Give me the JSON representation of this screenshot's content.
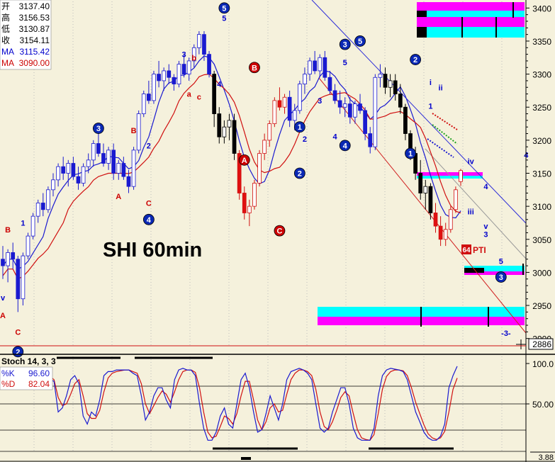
{
  "chart_data": {
    "type": "candlestick",
    "title": "SHI 60min",
    "timeframe": "60min",
    "price_axis": {
      "ticks": [
        2900,
        2950,
        3000,
        3050,
        3100,
        3150,
        3200,
        3250,
        3300,
        3350,
        3400
      ],
      "tick_labels": [
        "2900",
        "2950",
        "3000",
        "3050",
        "3100",
        "3150",
        "3200",
        "3250",
        "3300",
        "3350",
        "3400"
      ],
      "ylim": [
        2890,
        3410
      ],
      "current_marker": "2886"
    },
    "info_box": [
      {
        "label": "开",
        "value": "3137.40",
        "color": "#000000"
      },
      {
        "label": "高",
        "value": "3156.53",
        "color": "#000000"
      },
      {
        "label": "低",
        "value": "3130.87",
        "color": "#000000"
      },
      {
        "label": "收",
        "value": "3154.11",
        "color": "#000000"
      },
      {
        "label": "MA",
        "value": "3115.42",
        "color": "#0000cc"
      },
      {
        "label": "MA",
        "value": "3090.00",
        "color": "#cc0000"
      }
    ],
    "ohlc": [
      [
        3020,
        3040,
        2990,
        3010
      ],
      [
        3010,
        3035,
        2985,
        3030
      ],
      [
        3030,
        3045,
        3005,
        3020
      ],
      [
        3020,
        3025,
        2940,
        2960
      ],
      [
        2960,
        3030,
        2950,
        3025
      ],
      [
        3025,
        3060,
        3020,
        3055
      ],
      [
        3055,
        3090,
        3050,
        3085
      ],
      [
        3085,
        3110,
        3075,
        3105
      ],
      [
        3105,
        3120,
        3085,
        3095
      ],
      [
        3095,
        3130,
        3090,
        3125
      ],
      [
        3125,
        3150,
        3115,
        3140
      ],
      [
        3140,
        3165,
        3130,
        3160
      ],
      [
        3160,
        3175,
        3140,
        3150
      ],
      [
        3150,
        3170,
        3130,
        3165
      ],
      [
        3165,
        3175,
        3140,
        3145
      ],
      [
        3145,
        3160,
        3125,
        3135
      ],
      [
        3135,
        3165,
        3130,
        3160
      ],
      [
        3160,
        3180,
        3150,
        3170
      ],
      [
        3170,
        3200,
        3160,
        3195
      ],
      [
        3195,
        3215,
        3175,
        3180
      ],
      [
        3180,
        3195,
        3160,
        3165
      ],
      [
        3165,
        3190,
        3155,
        3185
      ],
      [
        3185,
        3195,
        3140,
        3150
      ],
      [
        3150,
        3170,
        3140,
        3165
      ],
      [
        3165,
        3175,
        3140,
        3145
      ],
      [
        3145,
        3155,
        3120,
        3130
      ],
      [
        3130,
        3190,
        3125,
        3185
      ],
      [
        3185,
        3245,
        3180,
        3240
      ],
      [
        3240,
        3275,
        3235,
        3270
      ],
      [
        3270,
        3290,
        3255,
        3260
      ],
      [
        3260,
        3305,
        3255,
        3300
      ],
      [
        3300,
        3320,
        3280,
        3290
      ],
      [
        3290,
        3310,
        3275,
        3305
      ],
      [
        3305,
        3315,
        3285,
        3295
      ],
      [
        3295,
        3300,
        3275,
        3285
      ],
      [
        3285,
        3320,
        3280,
        3315
      ],
      [
        3315,
        3330,
        3295,
        3300
      ],
      [
        3300,
        3325,
        3290,
        3320
      ],
      [
        3320,
        3345,
        3310,
        3340
      ],
      [
        3340,
        3365,
        3330,
        3360
      ],
      [
        3360,
        3365,
        3320,
        3330
      ],
      [
        3330,
        3335,
        3295,
        3300
      ],
      [
        3300,
        3305,
        3220,
        3240
      ],
      [
        3240,
        3250,
        3195,
        3205
      ],
      [
        3205,
        3230,
        3195,
        3220
      ],
      [
        3220,
        3240,
        3200,
        3230
      ],
      [
        3230,
        3240,
        3170,
        3180
      ],
      [
        3180,
        3185,
        3110,
        3120
      ],
      [
        3120,
        3130,
        3080,
        3090
      ],
      [
        3090,
        3110,
        3070,
        3100
      ],
      [
        3100,
        3140,
        3095,
        3135
      ],
      [
        3135,
        3185,
        3130,
        3180
      ],
      [
        3180,
        3210,
        3170,
        3200
      ],
      [
        3200,
        3230,
        3190,
        3225
      ],
      [
        3225,
        3265,
        3220,
        3260
      ],
      [
        3260,
        3280,
        3245,
        3250
      ],
      [
        3250,
        3270,
        3240,
        3265
      ],
      [
        3265,
        3275,
        3220,
        3230
      ],
      [
        3230,
        3255,
        3215,
        3245
      ],
      [
        3245,
        3290,
        3240,
        3285
      ],
      [
        3285,
        3310,
        3270,
        3300
      ],
      [
        3300,
        3325,
        3290,
        3320
      ],
      [
        3320,
        3335,
        3300,
        3305
      ],
      [
        3305,
        3330,
        3295,
        3325
      ],
      [
        3325,
        3335,
        3290,
        3295
      ],
      [
        3295,
        3305,
        3270,
        3275
      ],
      [
        3275,
        3285,
        3255,
        3260
      ],
      [
        3260,
        3275,
        3240,
        3250
      ],
      [
        3250,
        3265,
        3235,
        3255
      ],
      [
        3255,
        3265,
        3225,
        3235
      ],
      [
        3235,
        3260,
        3225,
        3255
      ],
      [
        3255,
        3270,
        3240,
        3245
      ],
      [
        3245,
        3250,
        3200,
        3210
      ],
      [
        3210,
        3220,
        3180,
        3190
      ],
      [
        3190,
        3300,
        3185,
        3295
      ],
      [
        3295,
        3315,
        3280,
        3300
      ],
      [
        3300,
        3310,
        3270,
        3280
      ],
      [
        3280,
        3300,
        3265,
        3290
      ],
      [
        3290,
        3300,
        3260,
        3270
      ],
      [
        3270,
        3285,
        3240,
        3250
      ],
      [
        3250,
        3255,
        3200,
        3210
      ],
      [
        3210,
        3215,
        3170,
        3180
      ],
      [
        3180,
        3190,
        3140,
        3150
      ],
      [
        3150,
        3170,
        3110,
        3120
      ],
      [
        3120,
        3140,
        3095,
        3130
      ],
      [
        3130,
        3135,
        3080,
        3090
      ],
      [
        3090,
        3105,
        3060,
        3070
      ],
      [
        3070,
        3085,
        3040,
        3050
      ],
      [
        3050,
        3075,
        3040,
        3065
      ],
      [
        3065,
        3100,
        3060,
        3095
      ],
      [
        3095,
        3130,
        3090,
        3125
      ],
      [
        3137.4,
        3156.53,
        3130.87,
        3154.11
      ]
    ],
    "wave_labels": [
      {
        "text": "A",
        "i": 0,
        "price": 2935,
        "style": "plain",
        "color": "#cc0000"
      },
      {
        "text": "v",
        "i": 0,
        "price": 2962,
        "style": "plain",
        "color": "#0000cc"
      },
      {
        "text": "B",
        "i": 1,
        "price": 3065,
        "style": "plain",
        "color": "#cc0000"
      },
      {
        "text": "C",
        "i": 3,
        "price": 2910,
        "style": "plain",
        "color": "#cc0000"
      },
      {
        "text": "2",
        "i": 3,
        "price": 2880,
        "style": "circle",
        "color": "#0a28b4"
      },
      {
        "text": "1",
        "i": 4,
        "price": 3075,
        "style": "plain",
        "color": "#0000cc"
      },
      {
        "text": "3",
        "i": 19,
        "price": 3218,
        "style": "circle",
        "color": "#0a28b4"
      },
      {
        "text": "A",
        "i": 23,
        "price": 3115,
        "style": "plain",
        "color": "#cc0000"
      },
      {
        "text": "B",
        "i": 26,
        "price": 3215,
        "style": "plain",
        "color": "#cc0000"
      },
      {
        "text": "2",
        "i": 29,
        "price": 3192,
        "style": "plain",
        "color": "#0000cc"
      },
      {
        "text": "C",
        "i": 29,
        "price": 3105,
        "style": "plain",
        "color": "#cc0000"
      },
      {
        "text": "4",
        "i": 29,
        "price": 3080,
        "style": "circle",
        "color": "#0a28b4"
      },
      {
        "text": "3",
        "i": 36,
        "price": 3330,
        "style": "plain",
        "color": "#0000cc"
      },
      {
        "text": "b",
        "i": 38,
        "price": 3325,
        "style": "plain",
        "color": "#cc0000"
      },
      {
        "text": "a",
        "i": 37,
        "price": 3270,
        "style": "plain",
        "color": "#cc0000"
      },
      {
        "text": "c",
        "i": 39,
        "price": 3266,
        "style": "plain",
        "color": "#cc0000"
      },
      {
        "text": "4",
        "i": 43,
        "price": 3285,
        "style": "plain",
        "color": "#0000cc"
      },
      {
        "text": "5",
        "i": 44,
        "price": 3385,
        "style": "plain",
        "color": "#0000cc"
      },
      {
        "text": "5",
        "i": 44,
        "price": 3400,
        "style": "circle",
        "color": "#0a28b4"
      },
      {
        "text": "B",
        "i": 50,
        "price": 3310,
        "style": "circle",
        "color": "#cc0000"
      },
      {
        "text": "A",
        "i": 48,
        "price": 3170,
        "style": "circle",
        "color": "#cc0000"
      },
      {
        "text": "C",
        "i": 55,
        "price": 3063,
        "style": "circle",
        "color": "#cc0000"
      },
      {
        "text": "1",
        "i": 59,
        "price": 3220,
        "style": "circle",
        "color": "#0a28b4"
      },
      {
        "text": "2",
        "i": 60,
        "price": 3202,
        "style": "plain",
        "color": "#0000cc"
      },
      {
        "text": "2",
        "i": 59,
        "price": 3150,
        "style": "circle",
        "color": "#0a28b4"
      },
      {
        "text": "3",
        "i": 63,
        "price": 3260,
        "style": "plain",
        "color": "#0000cc"
      },
      {
        "text": "4",
        "i": 66,
        "price": 3206,
        "style": "plain",
        "color": "#0000cc"
      },
      {
        "text": "4",
        "i": 68,
        "price": 3192,
        "style": "circle",
        "color": "#0a28b4"
      },
      {
        "text": "3",
        "i": 68,
        "price": 3345,
        "style": "circle",
        "color": "#0a28b4"
      },
      {
        "text": "5",
        "i": 68,
        "price": 3318,
        "style": "plain",
        "color": "#0000cc"
      },
      {
        "text": "5",
        "i": 71,
        "price": 3350,
        "style": "circle",
        "color": "#0a28b4"
      },
      {
        "text": "1",
        "i": 81,
        "price": 3180,
        "style": "circle",
        "color": "#0a28b4"
      },
      {
        "text": "2",
        "i": 82,
        "price": 3322,
        "style": "circle",
        "color": "#0a28b4"
      },
      {
        "text": "i",
        "i": 85,
        "price": 3288,
        "style": "plain",
        "color": "#0000cc"
      },
      {
        "text": "ii",
        "i": 87,
        "price": 3280,
        "style": "plain",
        "color": "#0000cc"
      },
      {
        "text": "1",
        "i": 85,
        "price": 3252,
        "style": "plain",
        "color": "#0000cc"
      },
      {
        "text": "iv",
        "i": 93,
        "price": 3168,
        "style": "plain",
        "color": "#0000cc"
      },
      {
        "text": "4",
        "i": 96,
        "price": 3130,
        "style": "plain",
        "color": "#0000cc"
      },
      {
        "text": "iii",
        "i": 93,
        "price": 3092,
        "style": "plain",
        "color": "#0000cc"
      },
      {
        "text": "v",
        "i": 96,
        "price": 3070,
        "style": "plain",
        "color": "#0000cc"
      },
      {
        "text": "3",
        "i": 96,
        "price": 3058,
        "style": "plain",
        "color": "#0000cc"
      },
      {
        "text": "5",
        "i": 99,
        "price": 3017,
        "style": "plain",
        "color": "#0000cc"
      },
      {
        "text": "3",
        "i": 99,
        "price": 2993,
        "style": "circle",
        "color": "#0a28b4"
      },
      {
        "text": "4",
        "i": 104,
        "price": 3178,
        "style": "plain",
        "color": "#0000cc"
      },
      {
        "text": "-3-",
        "i": 100,
        "price": 2908,
        "style": "plain",
        "color": "#0000cc"
      }
    ],
    "pti": {
      "value": "64",
      "label": "PTI"
    },
    "chart_title": "SHI 60min",
    "oscillator": {
      "name": "Stoch 14, 3, 3",
      "k_label": "%K",
      "k_value": "96.60",
      "d_label": "%D",
      "d_value": "82.04",
      "ticks": [
        "100.0",
        "50.00"
      ],
      "bottom_label": "3.88",
      "k": [
        85,
        88,
        90,
        92,
        92,
        93,
        88,
        75,
        70,
        88,
        90,
        85,
        80,
        78,
        40,
        45,
        60,
        80,
        85,
        75,
        35,
        25,
        40,
        35,
        55,
        85,
        90,
        90,
        92,
        92,
        92,
        92,
        88,
        85,
        60,
        30,
        40,
        60,
        70,
        70,
        55,
        45,
        80,
        92,
        94,
        92,
        92,
        85,
        50,
        20,
        5,
        5,
        15,
        35,
        45,
        25,
        20,
        50,
        80,
        88,
        70,
        40,
        15,
        18,
        38,
        60,
        45,
        30,
        50,
        80,
        90,
        92,
        94,
        92,
        88,
        80,
        50,
        20,
        15,
        20,
        40,
        55,
        70,
        70,
        50,
        20,
        8,
        5,
        5,
        5,
        20,
        60,
        85,
        92,
        94,
        93,
        92,
        90,
        80,
        60,
        40,
        28,
        15,
        8,
        5,
        5,
        10,
        25,
        70,
        85,
        96.6
      ],
      "d": [
        80,
        85,
        88,
        90,
        91,
        92,
        90,
        82,
        76,
        80,
        86,
        87,
        84,
        80,
        58,
        48,
        50,
        62,
        75,
        80,
        60,
        38,
        32,
        32,
        42,
        65,
        82,
        88,
        90,
        91,
        92,
        92,
        90,
        88,
        75,
        50,
        38,
        48,
        58,
        66,
        62,
        52,
        65,
        80,
        90,
        92,
        92,
        89,
        70,
        40,
        15,
        8,
        10,
        22,
        35,
        32,
        25,
        38,
        60,
        78,
        78,
        55,
        30,
        18,
        28,
        45,
        50,
        40,
        42,
        62,
        80,
        88,
        92,
        92,
        90,
        85,
        68,
        40,
        22,
        18,
        28,
        42,
        58,
        65,
        60,
        38,
        18,
        8,
        6,
        5,
        12,
        38,
        68,
        84,
        90,
        92,
        92,
        91,
        85,
        70,
        52,
        38,
        24,
        13,
        8,
        6,
        8,
        16,
        40,
        68,
        82.04
      ]
    },
    "legend": []
  }
}
